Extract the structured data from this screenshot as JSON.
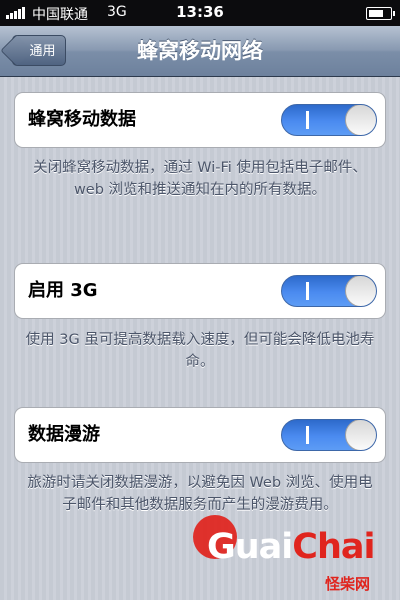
{
  "status_bar": {
    "carrier": "中国联通",
    "network": "3G",
    "time": "13:36",
    "battery_level": 0.6
  },
  "nav": {
    "back_label": "通用",
    "title": "蜂窝移动网络"
  },
  "settings": [
    {
      "label": "蜂窝移动数据",
      "on": true,
      "on_glyph": "I",
      "footer": "关闭蜂窝移动数据，通过 Wi-Fi 使用包括电子邮件、web 浏览和推送通知在内的所有数据。"
    },
    {
      "label": "启用 3G",
      "on": true,
      "on_glyph": "I",
      "footer": "使用 3G 虽可提高数据载入速度，但可能会降低电池寿命。"
    },
    {
      "label": "数据漫游",
      "on": true,
      "on_glyph": "I",
      "footer": "旅游时请关闭数据漫游，以避免因 Web 浏览、使用电子邮件和其他数据服务而产生的漫游费用。"
    }
  ],
  "watermark": {
    "brand_part1": "Guai",
    "brand_part2": "Chai",
    "cn": "怪柴网"
  },
  "colors": {
    "toggle_on": "#4b8bf0",
    "nav_bar": "#8899b1",
    "watermark": "#e0251e"
  },
  "icons": {
    "signal": "signal-bars-icon",
    "battery": "battery-icon",
    "back": "back-arrow-icon"
  }
}
